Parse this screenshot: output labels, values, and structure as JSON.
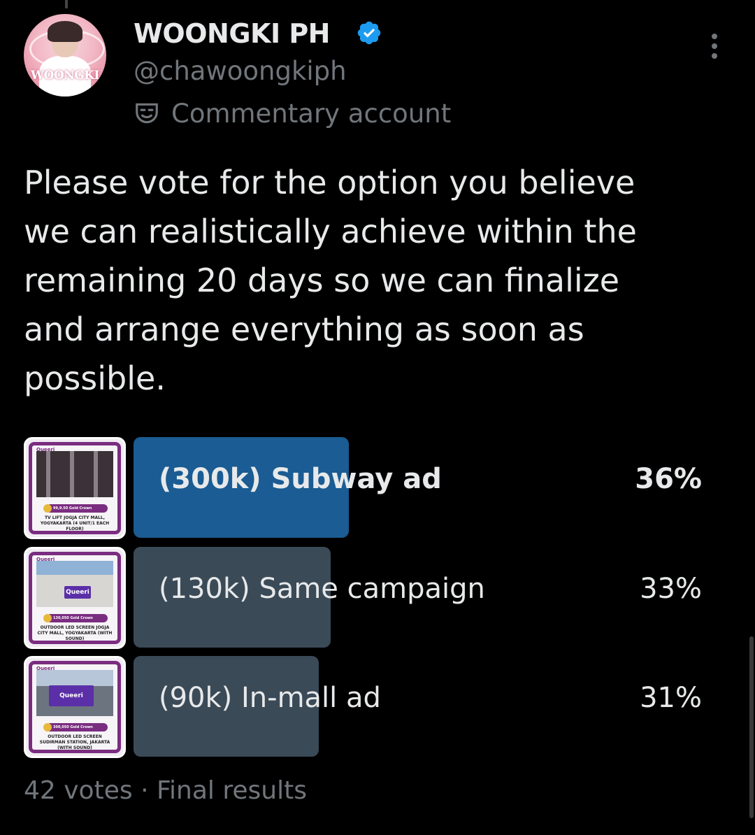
{
  "account": {
    "display_name": "WOONGKI PH",
    "handle": "@chawoongkiph",
    "label": "Commentary account",
    "avatar_text": "WOONGKI",
    "verified_color": "#1d9bf0",
    "verified_icon": "verified-badge-icon",
    "label_icon": "theater-masks-icon"
  },
  "tweet": {
    "text": "Please vote for the option you believe\nwe can realistically achieve within the\nremaining 20 days so we can finalize\nand arrange everything as soon as\npossible."
  },
  "poll": {
    "options": [
      {
        "label": "(300k) Subway ad",
        "percent_text": "36%",
        "percent": 36,
        "winner": true,
        "bar_color": "#1a5c93",
        "thumb": {
          "brand": "Queeri",
          "price": "99,9.50 Gold Crown",
          "caption": "TV LIFT JOGJA CITY MALL, YOGYAKARTA (4 UNIT/1 EACH FLOOR)"
        }
      },
      {
        "label": "(130k) Same campaign",
        "percent_text": "33%",
        "percent": 33,
        "winner": false,
        "bar_color": "#3b4a57",
        "thumb": {
          "brand": "Queeri",
          "price": "130,050 Gold Crown",
          "caption": "OUTDOOR LED SCREEN JOGJA CITY MALL, YOGYAKARTA (WITH SOUND)"
        }
      },
      {
        "label": "(90k) In-mall ad",
        "percent_text": "31%",
        "percent": 31,
        "winner": false,
        "bar_color": "#3b4a57",
        "thumb": {
          "brand": "Queeri",
          "price": "300,050 Gold Crown",
          "caption": "OUTDOOR LED SCREEN SUDIRMAN STATION, JAKARTA (WITH SOUND)"
        }
      }
    ],
    "votes": "42 votes",
    "separator": "·",
    "status": "Final results"
  },
  "more_icon": "more-options-icon"
}
